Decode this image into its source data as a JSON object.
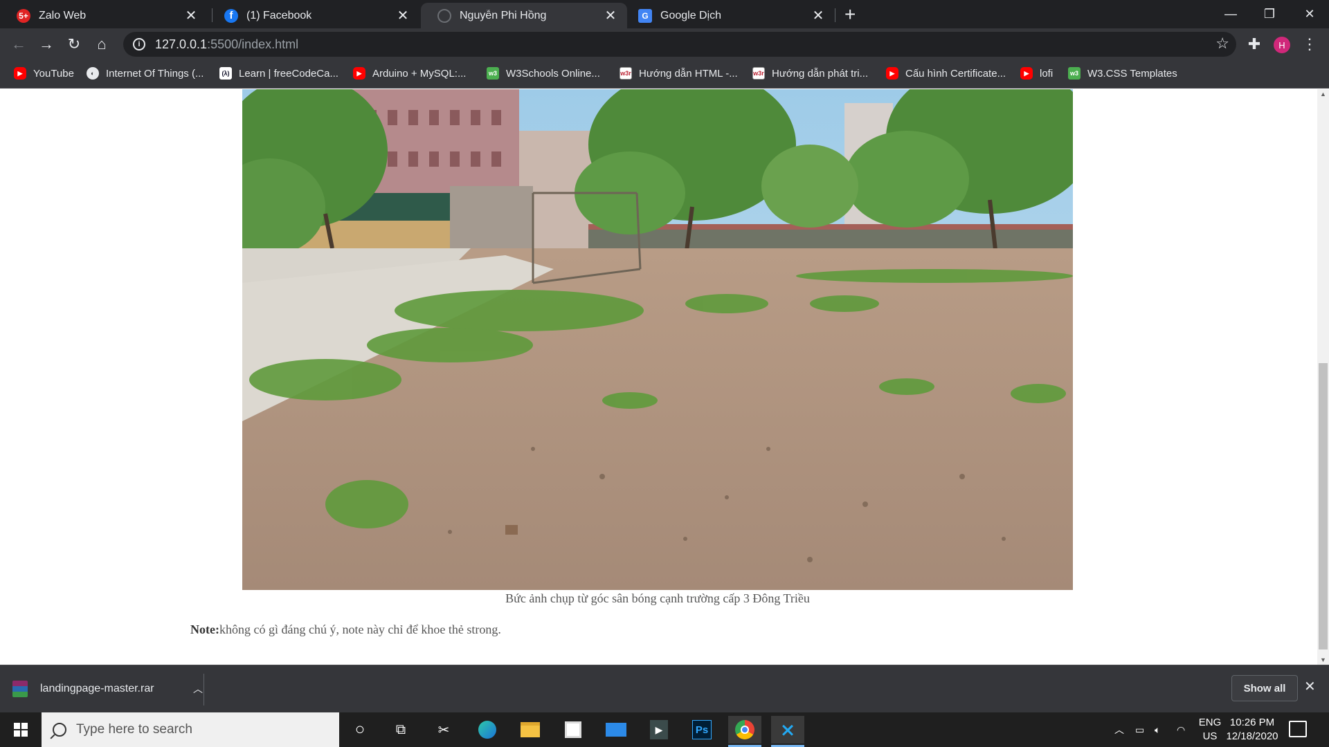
{
  "browser": {
    "tabs": [
      {
        "title": "Zalo Web",
        "icon": "zalo-icon"
      },
      {
        "title": "(1) Facebook",
        "icon": "facebook-icon"
      },
      {
        "title": "Nguyễn Phi Hồng",
        "icon": "globe-icon",
        "active": true
      },
      {
        "title": "Google Dịch",
        "icon": "google-translate-icon"
      }
    ],
    "url_host": "127.0.0.1",
    "url_rest": ":5500/index.html",
    "profile_initial": "H",
    "bookmarks": [
      {
        "label": "YouTube",
        "icon": "youtube-icon"
      },
      {
        "label": "Internet Of Things (...",
        "icon": "globe-icon"
      },
      {
        "label": "Learn | freeCodeCa...",
        "icon": "freecodecamp-icon"
      },
      {
        "label": "Arduino + MySQL:...",
        "icon": "youtube-icon"
      },
      {
        "label": "W3Schools Online...",
        "icon": "w3schools-icon"
      },
      {
        "label": "Hướng dẫn HTML -...",
        "icon": "w3r-icon"
      },
      {
        "label": "Hướng dẫn phát tri...",
        "icon": "w3r-icon"
      },
      {
        "label": "Cấu hình Certificate...",
        "icon": "youtube-icon"
      },
      {
        "label": "lofi",
        "icon": "youtube-icon"
      },
      {
        "label": "W3.CSS Templates",
        "icon": "w3schools-icon"
      }
    ]
  },
  "page": {
    "caption": "Bức ảnh chụp từ góc sân bóng cạnh trường cấp 3 Đông Triều",
    "note_label": "Note:",
    "note_text": "không có gì đáng chú ý, note này chỉ để khoe thẻ strong."
  },
  "downloads": {
    "filename": "landingpage-master.rar",
    "show_all": "Show all"
  },
  "taskbar": {
    "search_placeholder": "Type here to search",
    "lang_1": "ENG",
    "lang_2": "US",
    "time": "10:26 PM",
    "date": "12/18/2020"
  }
}
